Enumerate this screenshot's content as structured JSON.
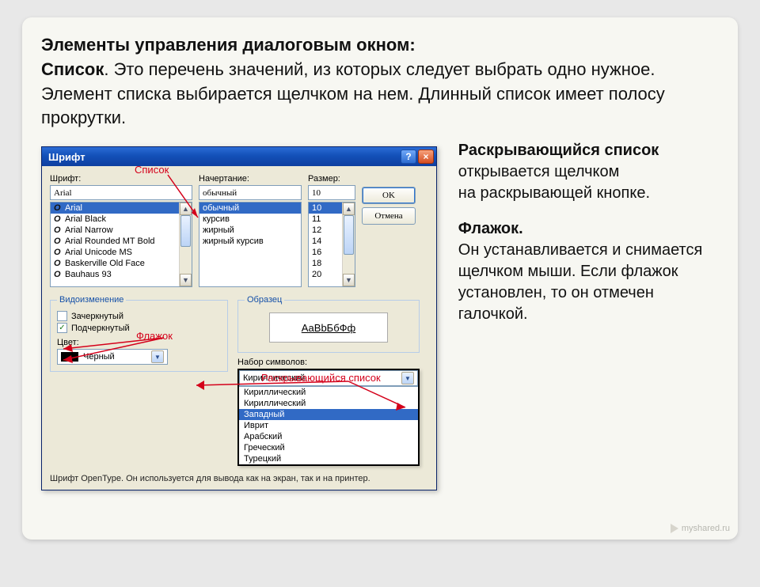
{
  "heading": {
    "title": "Элементы управления диалоговым окном:",
    "list_bold": "Список",
    "body": ". Это перечень значений, из которых следует выбрать одно нужное. Элемент списка выбирается щелчком на нем. Длинный список имеет полосу прокрутки."
  },
  "dialog": {
    "title": "Шрифт",
    "labels": {
      "font": "Шрифт:",
      "style": "Начертание:",
      "size": "Размер:",
      "effects_legend": "Видоизменение",
      "sample_legend": "Образец",
      "color": "Цвет:",
      "charset": "Набор символов:"
    },
    "inputs": {
      "font_value": "Arial",
      "style_value": "обычный",
      "size_value": "10",
      "color_value": "Черный",
      "charset_value": "Кириллический"
    },
    "font_list": [
      "Arial",
      "Arial Black",
      "Arial Narrow",
      "Arial Rounded MT Bold",
      "Arial Unicode MS",
      "Baskerville Old Face",
      "Bauhaus 93"
    ],
    "font_selected_index": 0,
    "style_list": [
      "обычный",
      "курсив",
      "жирный",
      "жирный курсив"
    ],
    "style_selected_index": 0,
    "size_list": [
      "10",
      "11",
      "12",
      "14",
      "16",
      "18",
      "20"
    ],
    "size_selected_index": 0,
    "buttons": {
      "ok": "OK",
      "cancel": "Отмена"
    },
    "checks": {
      "strike": "Зачеркнутый",
      "underline": "Подчеркнутый",
      "strike_on": false,
      "underline_on": true
    },
    "sample": "АаBbБбФф",
    "charset_list": [
      "Кириллический",
      "Кириллический",
      "Западный",
      "Иврит",
      "Арабский",
      "Греческий",
      "Турецкий"
    ],
    "charset_selected_index": 2,
    "hint_line": "Шрифт OpenType. Он используется для вывода как на экран, так и на принтер."
  },
  "annotations": {
    "list": "Список",
    "checkbox": "Флажок",
    "dropdown": "Раскрывающийся список"
  },
  "side": {
    "p1_bold": "Раскрывающийся список",
    "p1_rest": " открывается щелчком\n на раскрывающей кнопке.",
    "p2_bold": "Флажок.",
    "p2_rest": "\nОн устанавливается и снимается щелчком мыши. Если флажок установлен, то он отмечен галочкой."
  },
  "watermark": "myshared.ru"
}
